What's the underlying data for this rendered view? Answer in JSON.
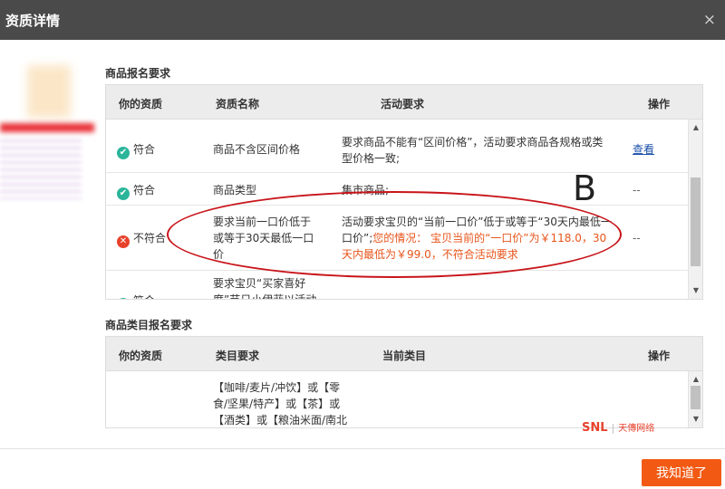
{
  "window": {
    "title": "资质详情",
    "close_glyph": "×"
  },
  "section1": {
    "title": "商品报名要求",
    "headers": [
      "你的资质",
      "资质名称",
      "活动要求",
      "操作"
    ],
    "rows": [
      {
        "status": "符合",
        "status_type": "ok",
        "name": "商品不含区间价格",
        "req_lines": [
          "要求商品不能有“区间价格”，活动要求商品各规格或类",
          "型价格一致;"
        ],
        "action": "查看"
      },
      {
        "status": "符合",
        "status_type": "ok",
        "name": "商品类型",
        "req_lines": [
          "集市商品;"
        ],
        "action": "--"
      },
      {
        "status": "不符合",
        "status_type": "bad",
        "name_lines": [
          "要求当前一口价低于",
          "或等于30天最低一口",
          "价"
        ],
        "req_lines_black": [
          "活动要求宝贝的“当前一口价”低于或等于“30天内最低一",
          "口价”;"
        ],
        "req_orange_inline": "您的情况：  宝贝当前的“一口价”为￥118.0，30",
        "req_orange_line2": "天内最低为￥99.0，不符合活动要求",
        "action": "--"
      },
      {
        "status": "符合",
        "status_type": "ok",
        "name_lines": [
          "要求宝贝“买家喜好",
          "度”节日小伊菲以活动"
        ],
        "action": ""
      }
    ]
  },
  "section2": {
    "title": "商品类目报名要求",
    "headers": [
      "你的资质",
      "类目要求",
      "当前类目",
      "操作"
    ],
    "row_lines": [
      "【咖啡/麦片/冲饮】或【零",
      "食/坚果/特产】或【茶】或",
      "【酒类】或【粮油米面/南北"
    ]
  },
  "annotation": {
    "label": "B"
  },
  "watermark": {
    "brand": "SNL",
    "sep": "|",
    "text": "天傳网络"
  },
  "footer": {
    "ok_label": "我知道了"
  },
  "colors": {
    "titlebar": "#4a4a4a",
    "ok_green": "#2bb59a",
    "fail_red": "#e8412b",
    "warn_orange": "#e8541a",
    "link_blue": "#1a4fa8",
    "button_orange": "#f25a14"
  }
}
